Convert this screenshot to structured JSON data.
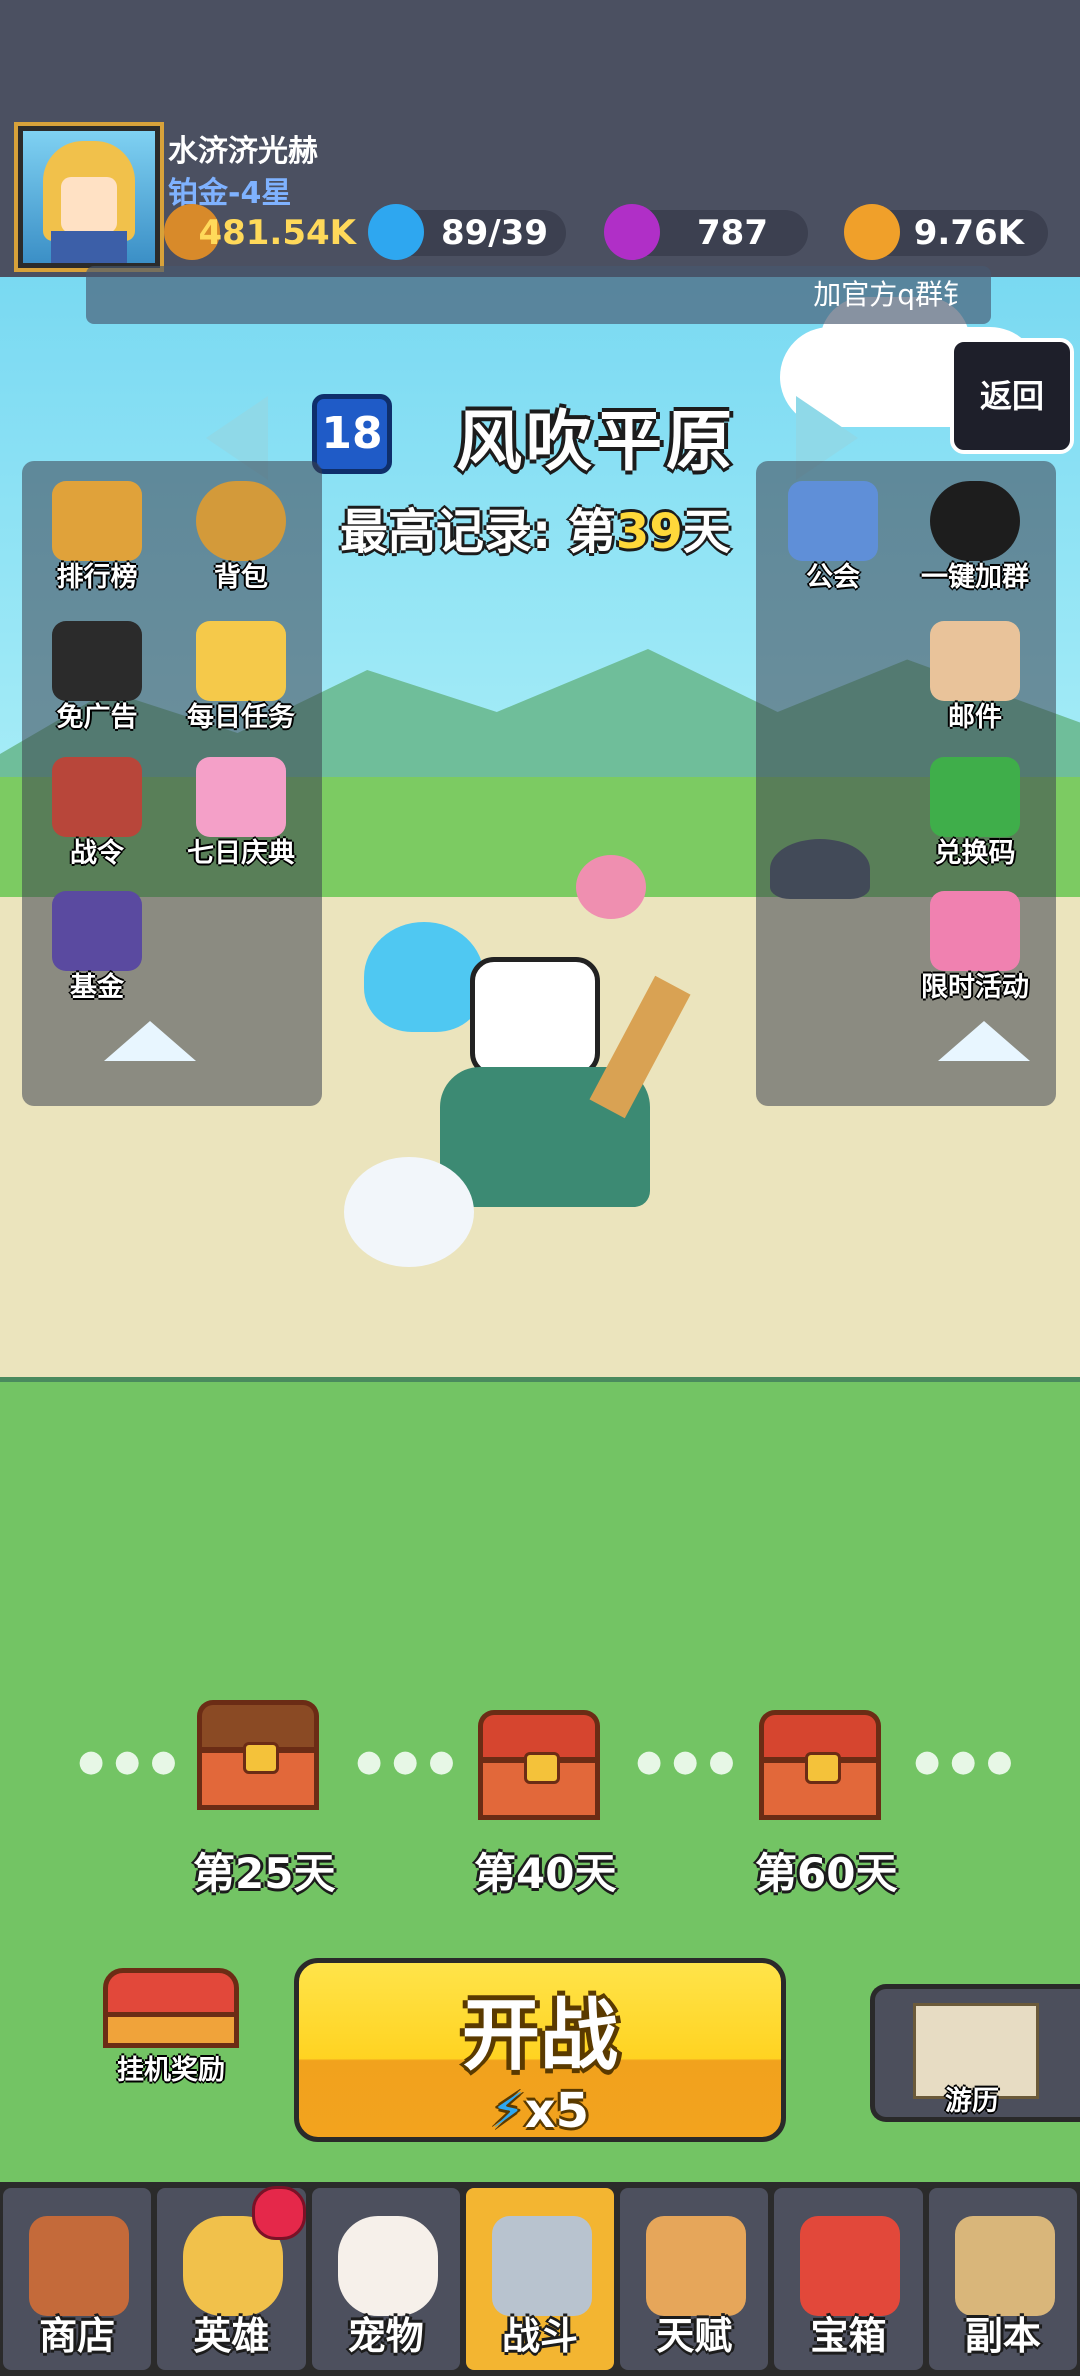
{
  "player": {
    "name": "水济济光赫",
    "rank": "铂金-4星",
    "power": "481.54K",
    "energy": "89/39",
    "gems": "787",
    "coins": "9.76K"
  },
  "announcement": "加官方q群钅",
  "stage": {
    "level": "18",
    "name": "风吹平原",
    "record_prefix": "最高记录: 第",
    "record_day": "39",
    "record_suffix": "天"
  },
  "back_label": "返回",
  "left_menu": [
    {
      "label": "排行榜",
      "icon": "trophy-banner-icon"
    },
    {
      "label": "背包",
      "icon": "backpack-icon"
    },
    {
      "label": "免广告",
      "icon": "no-ads-icon"
    },
    {
      "label": "每日任务",
      "icon": "daily-task-icon"
    },
    {
      "label": "战令",
      "icon": "battle-pass-icon"
    },
    {
      "label": "七日庆典",
      "icon": "gift-icon"
    },
    {
      "label": "基金",
      "icon": "fund-safe-icon"
    }
  ],
  "right_menu": [
    {
      "label": "公会",
      "icon": "guild-icon"
    },
    {
      "label": "一键加群",
      "icon": "qq-penguin-icon"
    },
    {
      "label": "邮件",
      "icon": "mail-scroll-icon"
    },
    {
      "label": "兑换码",
      "icon": "redeem-code-icon"
    },
    {
      "label": "限时活动",
      "icon": "gacha-machine-icon"
    }
  ],
  "chests": [
    {
      "label": "第25天",
      "state": "opened"
    },
    {
      "label": "第40天",
      "state": "locked"
    },
    {
      "label": "第60天",
      "state": "locked"
    }
  ],
  "start": {
    "label": "开战",
    "cost": "x5"
  },
  "idle_reward_label": "挂机奖励",
  "travel_label": "游历",
  "bottom_nav": [
    {
      "label": "商店",
      "icon": "shop-icon",
      "active": false
    },
    {
      "label": "英雄",
      "icon": "hero-icon",
      "active": false
    },
    {
      "label": "宠物",
      "icon": "pet-icon",
      "active": false
    },
    {
      "label": "战斗",
      "icon": "crossed-swords-icon",
      "active": true
    },
    {
      "label": "天赋",
      "icon": "talent-fist-icon",
      "active": false
    },
    {
      "label": "宝箱",
      "icon": "treasure-chest-icon",
      "active": false
    },
    {
      "label": "副本",
      "icon": "dungeon-map-icon",
      "active": false
    }
  ],
  "colors": {
    "accent_yellow": "#ffd321",
    "record_number": "#ffd83a",
    "rank_blue": "#7fb2ff",
    "active_tab": "#f3b531"
  }
}
